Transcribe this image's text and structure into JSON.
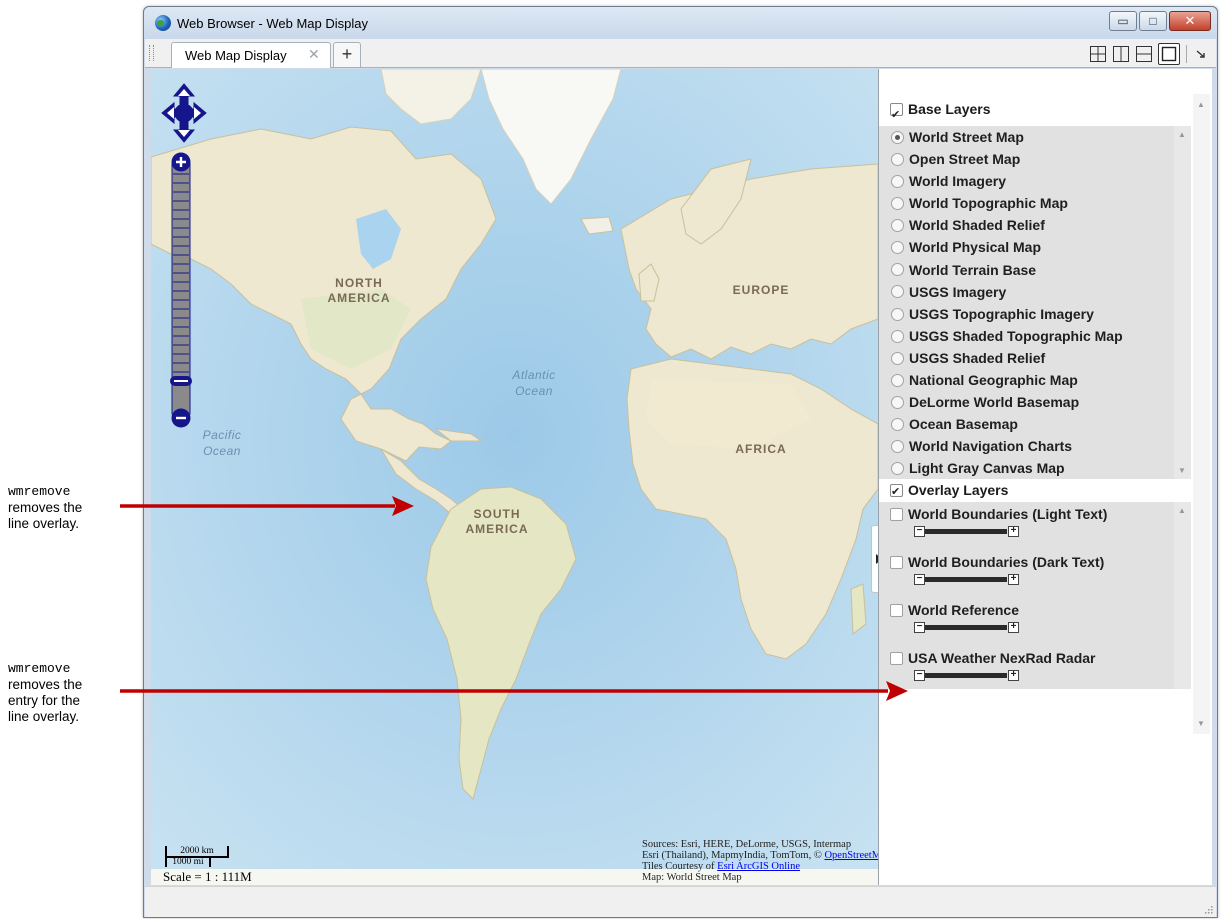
{
  "window": {
    "title": "Web Browser - Web Map Display",
    "minimize_glyph": "▭",
    "maximize_glyph": "□",
    "close_glyph": "✕"
  },
  "tabs": [
    {
      "label": "Web Map Display",
      "close_glyph": "✕"
    }
  ],
  "tab_add_glyph": "+",
  "map": {
    "continent_labels": {
      "north_america": "NORTH\nAMERICA",
      "europe": "EUROPE",
      "africa": "AFRICA",
      "south_america": "SOUTH\nAMERICA"
    },
    "ocean_labels": {
      "atlantic": "Atlantic\nOcean",
      "pacific": "Pacific\nOcean"
    },
    "scale": {
      "km": "2000 km",
      "mi": "1000 mi",
      "text": "Scale = 1 : 111M"
    },
    "attribution": {
      "line1": "Sources: Esri, HERE, DeLorme, USGS, Intermap",
      "line2_prefix": "Esri (Thailand), MapmyIndia, TomTom, © ",
      "line2_link": "OpenStreetMap contributors",
      "line3_prefix": "Tiles Courtesy of ",
      "line3_link": "Esri ArcGIS Online",
      "line4": "Map: World Street Map"
    }
  },
  "layers": {
    "base_header": "Base Layers",
    "base_header_checked": true,
    "base_layers": [
      {
        "label": "World Street Map",
        "selected": true
      },
      {
        "label": "Open Street Map",
        "selected": false
      },
      {
        "label": "World Imagery",
        "selected": false
      },
      {
        "label": "World Topographic Map",
        "selected": false
      },
      {
        "label": "World Shaded Relief",
        "selected": false
      },
      {
        "label": "World Physical Map",
        "selected": false
      },
      {
        "label": "World Terrain Base",
        "selected": false
      },
      {
        "label": "USGS Imagery",
        "selected": false
      },
      {
        "label": "USGS Topographic Imagery",
        "selected": false
      },
      {
        "label": "USGS Shaded Topographic Map",
        "selected": false
      },
      {
        "label": "USGS Shaded Relief",
        "selected": false
      },
      {
        "label": "National Geographic Map",
        "selected": false
      },
      {
        "label": "DeLorme World Basemap",
        "selected": false
      },
      {
        "label": "Ocean Basemap",
        "selected": false
      },
      {
        "label": "World Navigation Charts",
        "selected": false
      },
      {
        "label": "Light Gray Canvas Map",
        "selected": false
      }
    ],
    "overlay_header": "Overlay Layers",
    "overlay_header_checked": true,
    "overlay_layers": [
      {
        "label": "World Boundaries (Light Text)",
        "checked": false
      },
      {
        "label": "World Boundaries (Dark Text)",
        "checked": false
      },
      {
        "label": "World Reference",
        "checked": false
      },
      {
        "label": "USA Weather NexRad Radar",
        "checked": false
      }
    ],
    "opacity_minus": "−",
    "opacity_plus": "+"
  },
  "annotations": [
    {
      "code": "wmremove",
      "lines": [
        "removes the",
        "line overlay."
      ]
    },
    {
      "code": "wmremove",
      "lines": [
        "removes the",
        "entry for the",
        "line overlay."
      ]
    }
  ],
  "colors": {
    "ocean": "#c1ddf0",
    "land": "#efe9d3",
    "arrow": "#c00000",
    "nav_blue": "#15158c"
  }
}
